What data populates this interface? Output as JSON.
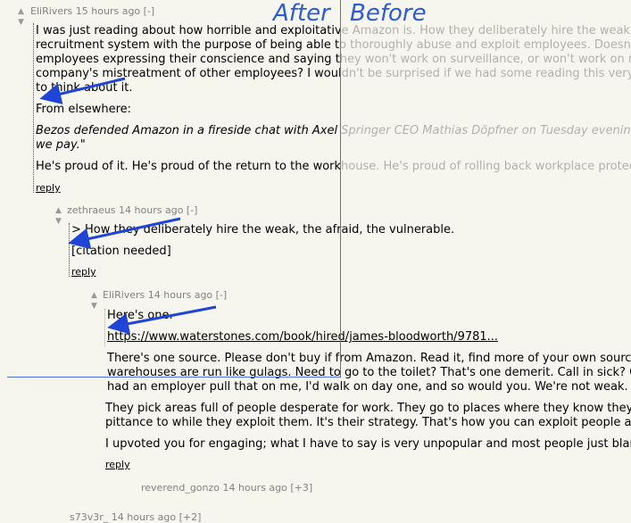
{
  "annotations": {
    "after_label": "After",
    "before_label": "Before"
  },
  "vote": {
    "up": "▲",
    "down": "▼"
  },
  "comments": [
    {
      "meta": "EliRivers 15 hours ago [-]",
      "lines": [
        "I was just reading about how horrible and exploitative Amazon is. How they deliberately hire the weak, the afraid, the vulnerable;",
        "recruitment system with the purpose of being able to thoroughly abuse and exploit employees. Doesn't make it",
        "employees expressing their conscience and saying they won't work on surveillance, or won't work on military p",
        "company's mistreatment of other employees? I wouldn't be surprised if we had some reading this very thread.",
        "to think about it."
      ],
      "from": "From elsewhere:",
      "quote_line1": "Bezos defended Amazon in a fireside chat with Axel Springer CEO Mathias Döpfner on Tuesday evening, saying",
      "quote_line2": "we pay.\"",
      "proud": "He's proud of it. He's proud of the return to the workhouse. He's proud of rolling back workplace protections. H",
      "reply": "reply"
    },
    {
      "meta": "zethraeus 14 hours ago [-]",
      "line1": "> How they deliberately hire the weak, the afraid, the vulnerable.",
      "line2": "[citation needed]",
      "reply": "reply"
    },
    {
      "meta": "EliRivers 14 hours ago [-]",
      "line1": "Here's one.",
      "link": "https://www.waterstones.com/book/hired/james-bloodworth/9781...",
      "para1a": "There's one source. Please don't buy if from Amazon. Read it, find more of your own sources, and",
      "para1b": "warehouses are run like gulags. Need to go to the toilet? That's one demerit. Call in sick? One de",
      "para1c": "had an employer pull that on me, I'd walk on day one, and so would you. We're not weak. We're",
      "para2a": "They pick areas full of people desperate for work. They go to places where they know they will ha",
      "para2b": "pittance to while they exploit them. It's their strategy. That's how you can exploit people and use",
      "para3": "I upvoted you for engaging; what I have to say is very unpopular and most people just blank it a",
      "reply": "reply"
    }
  ],
  "collapsed": [
    {
      "meta": "reverend_gonzo 14 hours ago [+3]"
    },
    {
      "meta": "s73v3r_ 14 hours ago [+2]"
    }
  ]
}
